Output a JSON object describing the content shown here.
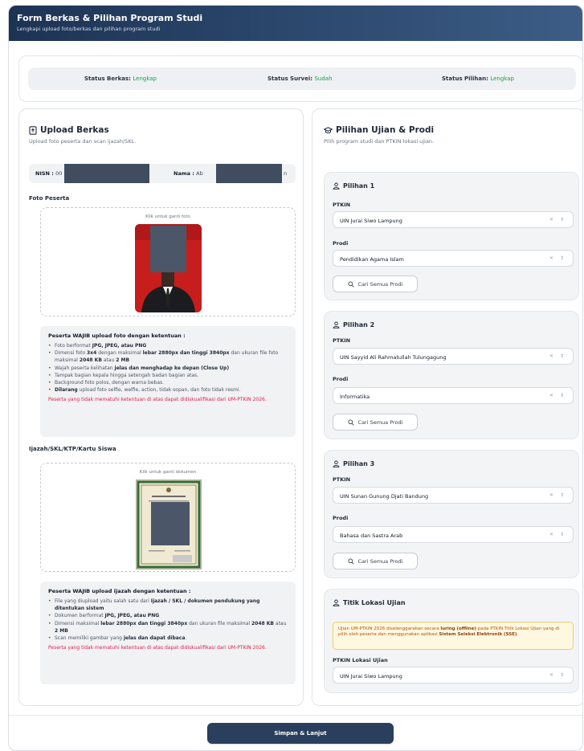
{
  "header": {
    "title": "Form Berkas & Pilihan Program Studi",
    "subtitle": "Lengkapi upload foto/berkas dan pilihan program studi"
  },
  "status": {
    "berkas_label": "Status Berkas:",
    "berkas_value": "Lengkap",
    "survei_label": "Status Survei:",
    "survei_value": "Sudah",
    "pilihan_label": "Status Pilihan:",
    "pilihan_value": "Lengkap",
    "value_color": "#16a34a"
  },
  "upload": {
    "title": "Upload Berkas",
    "subtitle": "Upload foto peserta dan scan ijazah/SKL.",
    "nisn_label": "NISN :",
    "nisn_value": "00",
    "nama_label": "Nama :",
    "nama_value": "Ab",
    "nama_suffix": "n",
    "foto_label": "Foto Peserta",
    "foto_hint": "Klik untuk ganti foto",
    "foto_rules_title": "Peserta WAJIB upload foto dengan ketentuan :",
    "foto_rules_warning": "Peserta yang tidak mematuhi ketentuan di atas dapat didiskualifikasi dari UM-PTKIN 2026.",
    "ijazah_label": "Ijazah/SKL/KTP/Kartu Siswa",
    "ijazah_hint": "Klik untuk ganti dokumen",
    "ijazah_rules_title": "Peserta WAJIB upload ijazah dengan ketentuan :",
    "ijazah_rules_warning": "Peserta yang tidak mematuhi ketentuan di atas dapat didiskualifikasi dari UM-PTKIN 2026."
  },
  "pilihan": {
    "title": "Pilihan Ujian & Prodi",
    "subtitle": "Pilih program studi dan PTKIN lokasi ujian.",
    "ptkin_label": "PTKIN",
    "prodi_label": "Prodi",
    "cari_label": "Cari Semua Prodi",
    "items": [
      {
        "title": "Pilihan 1",
        "ptkin": "UIN Jurai Siwo Lampung",
        "prodi": "Pendidikan Agama Islam"
      },
      {
        "title": "Pilihan 2",
        "ptkin": "UIN Sayyid Ali Rahmatullah Tulungagung",
        "prodi": "Informatika"
      },
      {
        "title": "Pilihan 3",
        "ptkin": "UIN Sunan Gunung Djati Bandung",
        "prodi": "Bahasa dan Sastra Arab"
      }
    ],
    "lokasi_title": "Titik Lokasi Ujian",
    "lokasi_label": "PTKIN Lokasi Ujian",
    "lokasi_value": "UIN Jurai Siwo Lampung"
  },
  "submit_label": "Simpan & Lanjut",
  "icons": {
    "upload": "file-upload-icon",
    "pilihan": "graduation-cap-icon",
    "user": "user-icon",
    "search": "search-icon",
    "select_controls": "clear-and-chevron-icon"
  }
}
